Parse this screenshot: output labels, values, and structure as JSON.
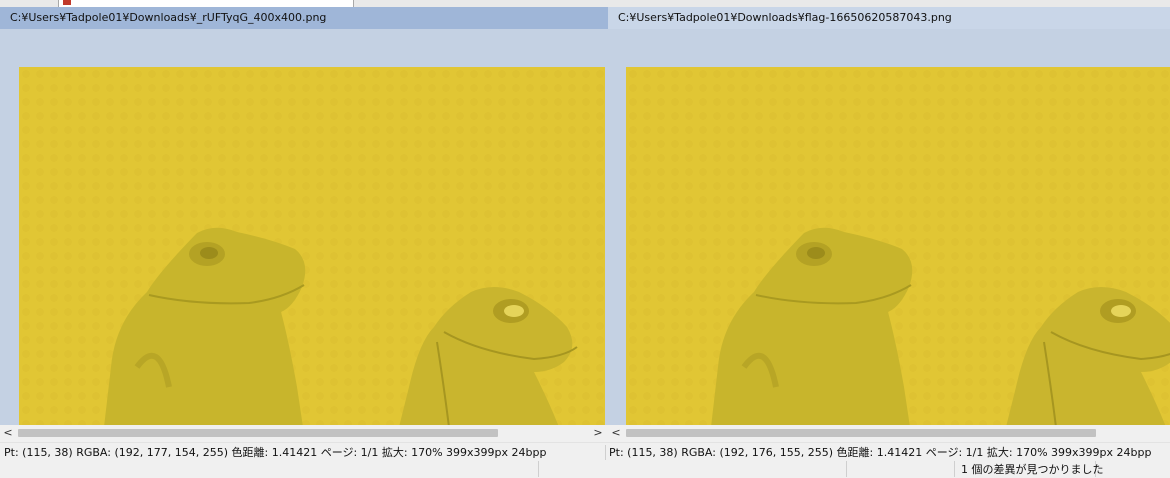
{
  "left_pane": {
    "path": "C:¥Users¥Tadpole01¥Downloads¥_rUFTyqG_400x400.png",
    "scroll": {
      "left_arrow": "<",
      "right_arrow": ">"
    }
  },
  "right_pane": {
    "path": "C:¥Users¥Tadpole01¥Downloads¥flag-16650620587043.png",
    "scroll": {
      "left_arrow": "<"
    }
  },
  "status": {
    "left": {
      "text": "Pt: (115, 38)  RGBA: (192, 177, 154, 255)  色距離: 1.41421  ページ: 1/1  拡大: 170%  399x399px  24bpp"
    },
    "right": {
      "text": "Pt: (115, 38)  RGBA: (192, 176, 155, 255)  色距離: 1.41421  ページ: 1/1  拡大: 170%  399x399px  24bpp"
    },
    "result": "1 個の差異が見つかりました"
  },
  "colors": {
    "image_yellow": "#e1c634",
    "frog": "#c9b52e",
    "title_active": "#9fb6d8",
    "title_inactive": "#c9d6e8"
  }
}
